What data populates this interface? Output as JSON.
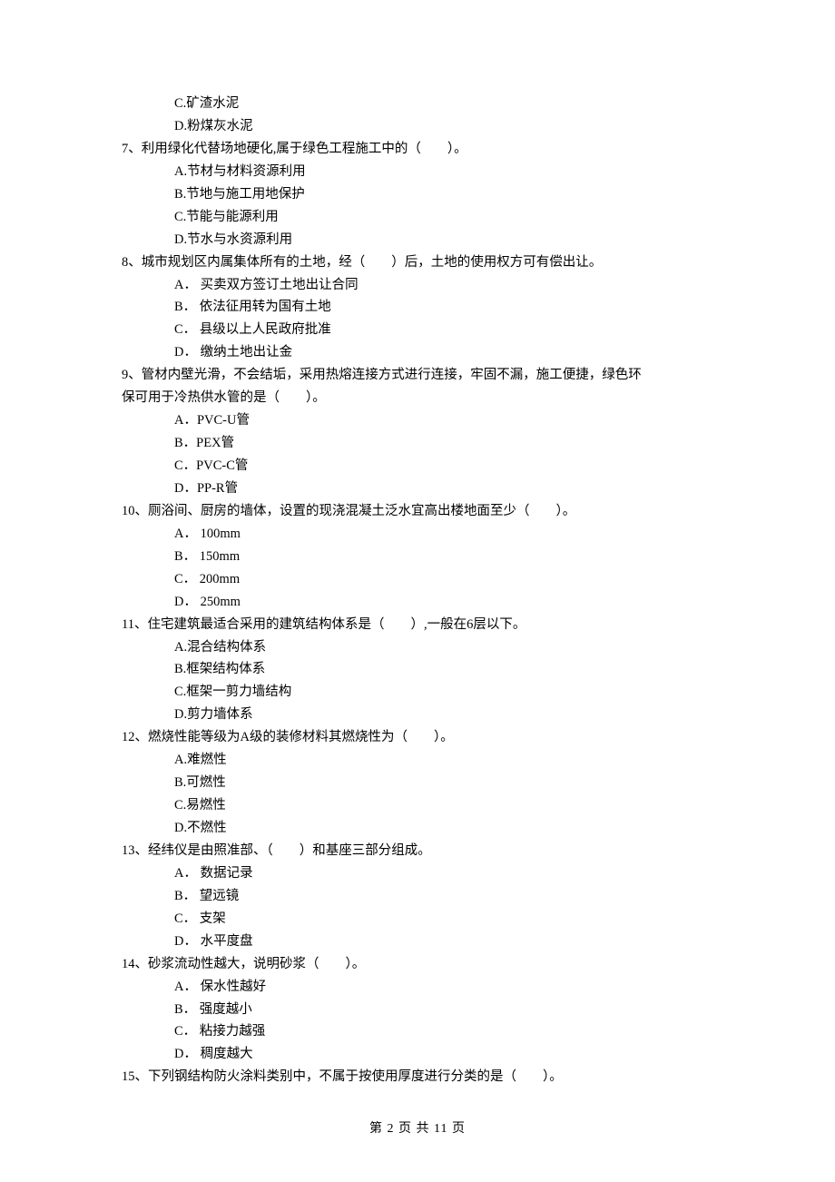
{
  "q6_opts": {
    "c": "C.矿渣水泥",
    "d": "D.粉煤灰水泥"
  },
  "q7": {
    "stem": "7、利用绿化代替场地硬化,属于绿色工程施工中的（　　）。",
    "a": "A.节材与材料资源利用",
    "b": "B.节地与施工用地保护",
    "c": "C.节能与能源利用",
    "d": "D.节水与水资源利用"
  },
  "q8": {
    "stem": "8、城市规划区内属集体所有的土地，经（　　）后，土地的使用权方可有偿出让。",
    "a": "A． 买卖双方签订土地出让合同",
    "b": "B． 依法征用转为国有土地",
    "c": "C． 县级以上人民政府批准",
    "d": "D． 缴纳土地出让金"
  },
  "q9": {
    "stem1": "9、管材内壁光滑，不会结垢，采用热熔连接方式进行连接，牢固不漏，施工便捷，绿色环",
    "stem2": "保可用于冷热供水管的是（　　）。",
    "a": "A．PVC-U管",
    "b": "B．PEX管",
    "c": "C．PVC-C管",
    "d": "D．PP-R管"
  },
  "q10": {
    "stem": "10、厕浴间、厨房的墙体，设置的现浇混凝土泛水宜高出楼地面至少（　　）。",
    "a": "A． 100mm",
    "b": "B． 150mm",
    "c": "C． 200mm",
    "d": "D． 250mm"
  },
  "q11": {
    "stem": "11、住宅建筑最适合采用的建筑结构体系是（　　）,一般在6层以下。",
    "a": "A.混合结构体系",
    "b": "B.框架结构体系",
    "c": "C.框架一剪力墙结构",
    "d": "D.剪力墙体系"
  },
  "q12": {
    "stem": "12、燃烧性能等级为A级的装修材料其燃烧性为（　　）。",
    "a": "A.难燃性",
    "b": "B.可燃性",
    "c": "C.易燃性",
    "d": "D.不燃性"
  },
  "q13": {
    "stem": "13、经纬仪是由照准部、（　　）和基座三部分组成。",
    "a": "A． 数据记录",
    "b": "B． 望远镜",
    "c": "C． 支架",
    "d": "D． 水平度盘"
  },
  "q14": {
    "stem": "14、砂浆流动性越大，说明砂浆（　　）。",
    "a": "A． 保水性越好",
    "b": "B． 强度越小",
    "c": "C． 粘接力越强",
    "d": "D． 稠度越大"
  },
  "q15": {
    "stem": "15、下列钢结构防火涂料类别中，不属于按使用厚度进行分类的是（　　）。"
  },
  "footer": "第 2 页 共 11 页"
}
